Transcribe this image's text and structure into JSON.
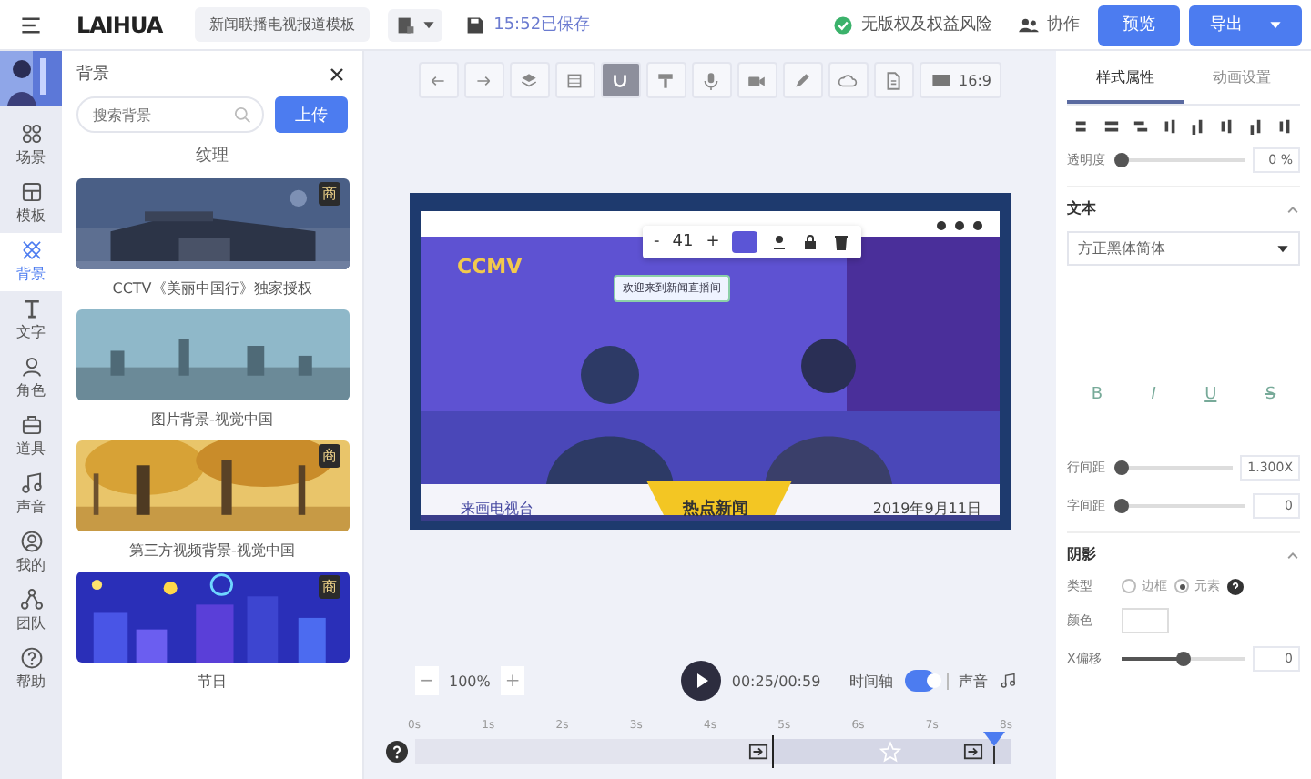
{
  "topbar": {
    "logo": "LAIHUA",
    "template_name": "新闻联播电视报道模板",
    "save_status": "15:52已保存",
    "copyright_note": "无版权及权益风险",
    "collab": "协作",
    "preview_button": "预览",
    "export_button": "导出"
  },
  "rail": [
    {
      "kind": "scene",
      "label": "场景",
      "selected": false
    },
    {
      "kind": "template",
      "label": "模板",
      "selected": false
    },
    {
      "kind": "background",
      "label": "背景",
      "selected": true
    },
    {
      "kind": "text",
      "label": "文字",
      "selected": false
    },
    {
      "kind": "role",
      "label": "角色",
      "selected": false
    },
    {
      "kind": "prop",
      "label": "道具",
      "selected": false
    },
    {
      "kind": "sound",
      "label": "声音",
      "selected": false
    },
    {
      "kind": "mine",
      "label": "我的",
      "selected": false
    },
    {
      "kind": "team",
      "label": "团队",
      "selected": false
    },
    {
      "kind": "help",
      "label": "帮助",
      "selected": false
    }
  ],
  "panel": {
    "title": "背景",
    "search": {
      "placeholder": "搜索背景"
    },
    "upload_button": "上传",
    "category": "纹理",
    "cards": [
      {
        "kind": "building",
        "caption": "CCTV《美丽中国行》独家授权",
        "badge": "商"
      },
      {
        "kind": "city",
        "caption": "图片背景-视觉中国"
      },
      {
        "kind": "forest",
        "caption": "第三方视频背景-视觉中国",
        "badge": "商"
      },
      {
        "kind": "festival",
        "caption": "节日",
        "badge": "商"
      }
    ]
  },
  "toolbar": {
    "tools": [
      {
        "kind": "undo",
        "selected": false
      },
      {
        "kind": "redo",
        "selected": false
      },
      {
        "kind": "layers",
        "selected": false
      },
      {
        "kind": "grid",
        "selected": false
      },
      {
        "kind": "magnet",
        "selected": true
      },
      {
        "kind": "brush",
        "selected": false
      },
      {
        "kind": "mic",
        "selected": false
      },
      {
        "kind": "camera",
        "selected": false
      },
      {
        "kind": "pen",
        "selected": false
      },
      {
        "kind": "cloud",
        "selected": false
      },
      {
        "kind": "doc",
        "selected": false
      }
    ],
    "aspect": "16:9"
  },
  "stage": {
    "brand": "CCMV",
    "size": "41",
    "minus": "-",
    "plus": "+",
    "bubble": "欢迎来到新闻直播间",
    "channel": "来画电视台",
    "headline": "热点新闻",
    "date": "2019年9月11日"
  },
  "playback": {
    "zoom_out": "−",
    "zoom": "100%",
    "zoom_in": "+",
    "time": "00:25/00:59",
    "timeline_label": "时间轴",
    "timeline_on": true,
    "sound_label": "声音"
  },
  "timeline": {
    "ticks": [
      "0s",
      "1s",
      "2s",
      "3s",
      "4s",
      "5s",
      "6s",
      "7s",
      "8s"
    ],
    "level": 0.6
  },
  "properties": {
    "tabs": [
      {
        "label": "样式属性",
        "selected": true
      },
      {
        "label": "动画设置",
        "selected": false
      }
    ],
    "opacity": {
      "label": "透明度",
      "level": 0,
      "reading": "0",
      "unit": "%"
    },
    "text_section": {
      "title": "文本",
      "expanded": true,
      "font": "方正黑体简体",
      "styles": [
        "B",
        "I",
        "U",
        "S"
      ]
    },
    "line_spacing": {
      "label": "行间距",
      "level": 0,
      "reading": "1.300X"
    },
    "letter_spacing": {
      "label": "字间距",
      "level": 0,
      "reading": "0"
    },
    "shadow": {
      "title": "阴影",
      "expanded": true,
      "type_label": "类型",
      "types": [
        {
          "label": "边框",
          "selected": false
        },
        {
          "label": "元素",
          "selected": true
        }
      ],
      "color_label": "颜色",
      "x_offset": {
        "label": "X偏移",
        "level": 0.5,
        "reading": "0"
      }
    }
  }
}
